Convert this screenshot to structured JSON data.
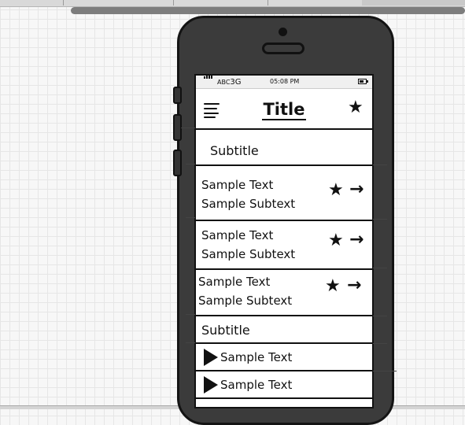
{
  "status_bar": {
    "carrier": "ABC",
    "network": "3G",
    "time": "05:08 PM"
  },
  "nav_bar": {
    "title": "Title",
    "menu_icon": "hamburger-menu-icon",
    "star_icon": "star-icon"
  },
  "list": {
    "subtitle_1": "Subtitle",
    "items": [
      {
        "text": "Sample Text",
        "subtext": "Sample Subtext"
      },
      {
        "text": "Sample Text",
        "subtext": "Sample Subtext"
      },
      {
        "text": "Sample Text",
        "subtext": "Sample Subtext"
      }
    ],
    "subtitle_2": "Subtitle",
    "play_items": [
      {
        "text": "Sample Text"
      },
      {
        "text": "Sample Text"
      }
    ]
  },
  "glyphs": {
    "star": "★",
    "arrow": "→"
  }
}
